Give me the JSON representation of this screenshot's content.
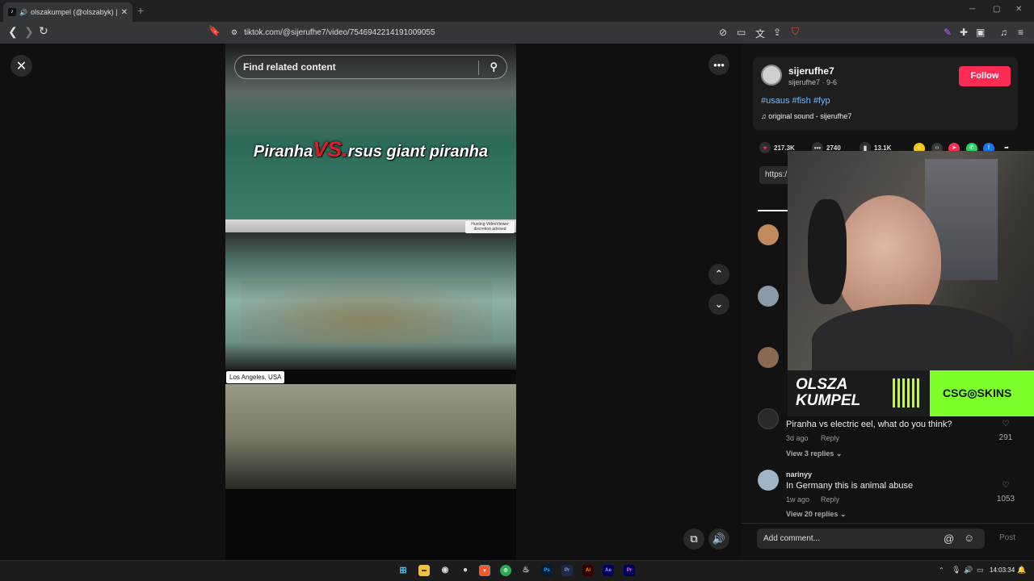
{
  "browser": {
    "tab_title": "olszakumpel (@olszabyk) | Ti",
    "tab_audio_icon": "speaker-icon",
    "new_tab_label": "+",
    "url": "tiktok.com/@sijerufhe7/video/7546942214191009055"
  },
  "video": {
    "search_placeholder": "Find related content",
    "caption_part1": "Piranha",
    "caption_vs": "VS.",
    "caption_part2": "rsus giant piranha",
    "hunting_label": "Hunting VideoViewer discretion advised",
    "location": "Los Angeles, USA"
  },
  "post": {
    "username": "sijerufhe7",
    "detail": "sijerufhe7 · 9-6",
    "follow_label": "Follow",
    "tags": "#usaus #fish #fyp",
    "sound": "original sound - sijerufhe7",
    "likes": "217.3K",
    "comments": "2740",
    "saves": "13.1K",
    "link_text": "https:/"
  },
  "webcam_overlay": {
    "brand_left": "OLSZA KUMPEL",
    "brand_right": "CSG◎SKINS"
  },
  "comments": [
    {
      "text": "Piranha vs electric eel, what do you think?",
      "age": "3d ago",
      "reply": "Reply",
      "likes": "291",
      "view_replies": "View 3 replies"
    },
    {
      "name": "narinyy",
      "text": "In Germany this is animal abuse",
      "age": "1w ago",
      "reply": "Reply",
      "likes": "1053",
      "view_replies": "View 20 replies"
    }
  ],
  "comment_bar": {
    "placeholder": "Add comment...",
    "post_label": "Post"
  },
  "taskbar": {
    "time": "14:03:34"
  },
  "colors": {
    "follow": "#fe2c55",
    "accent_red": "#e21b2a",
    "hashtag": "#79b8ff"
  }
}
